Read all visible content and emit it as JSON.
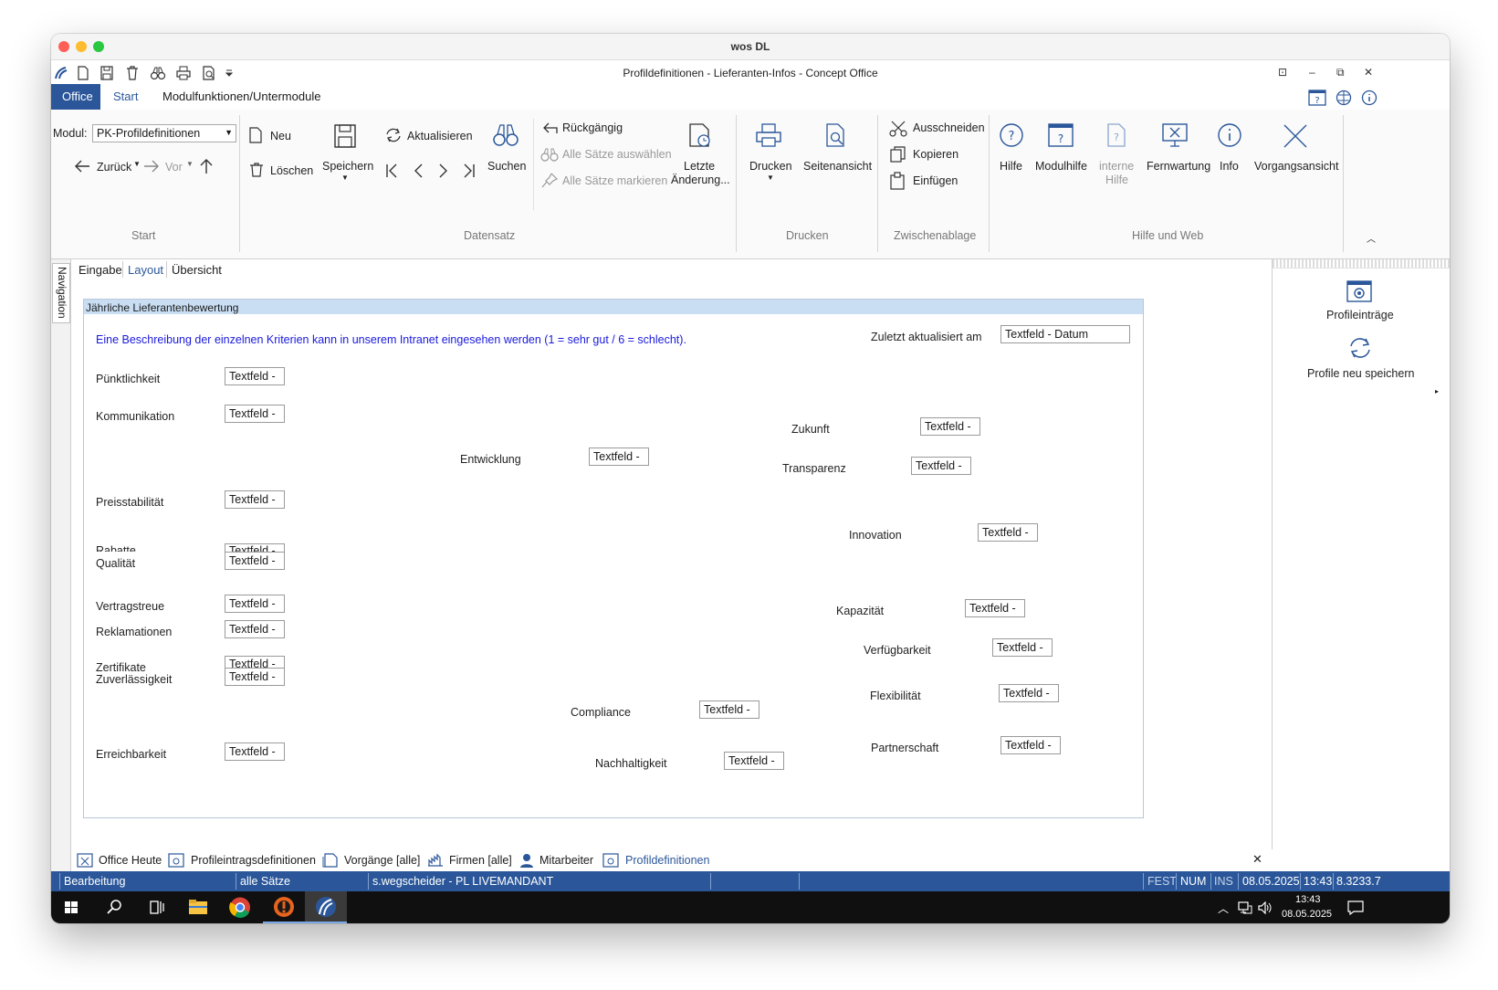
{
  "mac_title": "wos DL",
  "app_title": "Profildefinitionen - Lieferanten-Infos - Concept Office",
  "tabs": [
    "Office",
    "Start",
    "Modulfunktionen/Untermodule"
  ],
  "ribbon": {
    "modul_label": "Modul:",
    "modul_value": "PK-Profildefinitionen",
    "zurueck": "Zurück",
    "vor": "Vor",
    "neu": "Neu",
    "loeschen": "Löschen",
    "speichern": "Speichern",
    "aktualisieren": "Aktualisieren",
    "suchen": "Suchen",
    "rueckgaengig": "Rückgängig",
    "alle_saetze_auswaehlen": "Alle Sätze auswählen",
    "alle_saetze_markieren": "Alle Sätze markieren",
    "letzte_aenderung_1": "Letzte",
    "letzte_aenderung_2": "Änderung...",
    "drucken": "Drucken",
    "seitenansicht": "Seitenansicht",
    "ausschneiden": "Ausschneiden",
    "kopieren": "Kopieren",
    "einfuegen": "Einfügen",
    "hilfe": "Hilfe",
    "modulhilfe": "Modulhilfe",
    "interne_hilfe_1": "interne",
    "interne_hilfe_2": "Hilfe",
    "fernwartung": "Fernwartung",
    "info": "Info",
    "vorgangsansicht": "Vorgangsansicht",
    "groups": {
      "start": "Start",
      "datensatz": "Datensatz",
      "drucken": "Drucken",
      "zwischenablage": "Zwischenablage",
      "hilfe_web": "Hilfe und Web"
    }
  },
  "navigation_label": "Navigation",
  "subtabs": [
    "Eingabe",
    "Layout",
    "Übersicht"
  ],
  "panel": {
    "title": "Jährliche Lieferantenbewertung",
    "description": "Eine Beschreibung der einzelnen Kriterien kann in unserem Intranet eingesehen werden (1 = sehr gut / 6 = schlecht).",
    "updated_label": "Zuletzt aktualisiert am",
    "updated_field": "Textfeld - Datum",
    "textfield": "Textfeld -",
    "labels": {
      "puenktlichkeit": "Pünktlichkeit",
      "kommunikation": "Kommunikation",
      "entwicklung": "Entwicklung",
      "zukunft": "Zukunft",
      "transparenz": "Transparenz",
      "preisstabilitaet": "Preisstabilität",
      "innovation": "Innovation",
      "rabatte": "Rabatte",
      "qualitaet": "Qualität",
      "vertragstreue": "Vertragstreue",
      "reklamationen": "Reklamationen",
      "kapazitaet": "Kapazität",
      "verfuegbarkeit": "Verfügbarkeit",
      "zertifikate": "Zertifikate",
      "zuverlaessigkeit": "Zuverlässigkeit",
      "flexibilitaet": "Flexibilität",
      "compliance": "Compliance",
      "partnerschaft": "Partnerschaft",
      "erreichbarkeit": "Erreichbarkeit",
      "nachhaltigkeit": "Nachhaltigkeit"
    }
  },
  "right_pane": {
    "profileintraege": "Profileinträge",
    "profile_neu_speichern": "Profile neu speichern"
  },
  "doc_tabs": [
    "Office Heute",
    "Profileintragsdefinitionen",
    "Vorgänge [alle]",
    "Firmen [alle]",
    "Mitarbeiter",
    "Profildefinitionen"
  ],
  "statusbar": {
    "mode": "Bearbeitung",
    "records": "alle Sätze",
    "user": "s.wegscheider - PL LIVEMANDANT",
    "fest": "FEST",
    "num": "NUM",
    "ins": "INS",
    "date": "08.05.2025",
    "time": "13:43",
    "version": "8.3233.7"
  },
  "taskbar": {
    "time": "13:43",
    "date": "08.05.2025"
  },
  "colors": {
    "accent": "#2b579a",
    "panel_header": "#c9def3",
    "description_text": "#1a1adc"
  }
}
